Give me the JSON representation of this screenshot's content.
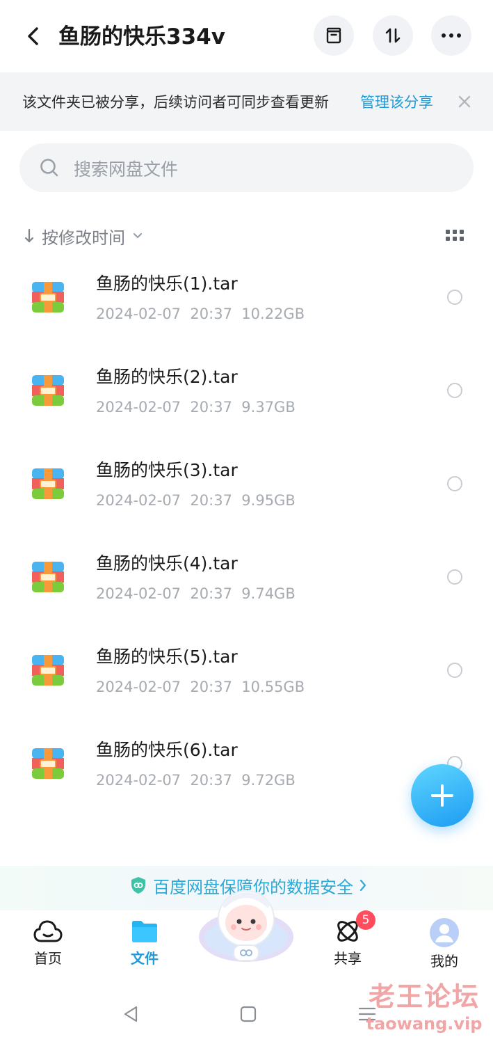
{
  "header": {
    "title": "鱼肠的快乐334v",
    "icons": [
      "back-chevron-icon",
      "archive-icon",
      "sort-toggle-icon",
      "more-icon"
    ]
  },
  "share_notice": {
    "text": "该文件夹已被分享，后续访问者可同步查看更新",
    "link": "管理该分享"
  },
  "search": {
    "placeholder": "搜索网盘文件"
  },
  "sort": {
    "label": "按修改时间"
  },
  "files": [
    {
      "name": "鱼肠的快乐(1).tar",
      "date": "2024-02-07",
      "time": "20:37",
      "size": "10.22GB"
    },
    {
      "name": "鱼肠的快乐(2).tar",
      "date": "2024-02-07",
      "time": "20:37",
      "size": "9.37GB"
    },
    {
      "name": "鱼肠的快乐(3).tar",
      "date": "2024-02-07",
      "time": "20:37",
      "size": "9.95GB"
    },
    {
      "name": "鱼肠的快乐(4).tar",
      "date": "2024-02-07",
      "time": "20:37",
      "size": "9.74GB"
    },
    {
      "name": "鱼肠的快乐(5).tar",
      "date": "2024-02-07",
      "time": "20:37",
      "size": "10.55GB"
    },
    {
      "name": "鱼肠的快乐(6).tar",
      "date": "2024-02-07",
      "time": "20:37",
      "size": "9.72GB"
    }
  ],
  "security_banner": {
    "text": "百度网盘保障你的数据安全"
  },
  "bottom_nav": {
    "items": [
      {
        "label": "首页",
        "icon": "cloud-home-icon"
      },
      {
        "label": "文件",
        "icon": "folder-icon",
        "active": true
      },
      {
        "label": "共享",
        "icon": "share-orbit-icon",
        "badge": "5"
      },
      {
        "label": "我的",
        "icon": "avatar-icon"
      }
    ]
  },
  "watermark": {
    "line1": "老王论坛",
    "line2": "taowang.vip"
  },
  "colors": {
    "accent": "#1e9bd8",
    "badge": "#ff4d5e",
    "fab": "#1d9cf2"
  }
}
